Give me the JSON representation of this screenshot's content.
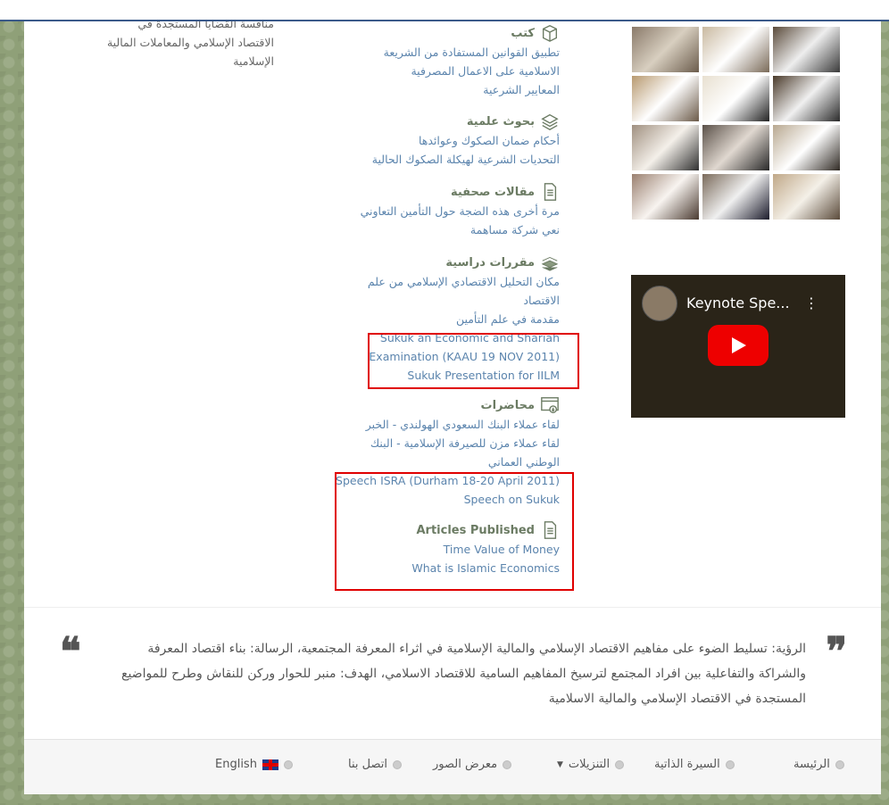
{
  "left_snippet": [
    "منافسة القضايا المستجدة في",
    "الاقتصاد الإسلامي والمعاملات المالية",
    "الإسلامية"
  ],
  "sections": {
    "books": {
      "title": "كتب",
      "icon": "book-icon",
      "links": [
        "تطبيق القوانين المستفادة من الشريعة",
        "الاسلامية على الاعمال المصرفية",
        "المعايير الشرعية"
      ]
    },
    "research": {
      "title": "بحوث علمية",
      "icon": "layers-icon",
      "links": [
        "أحكام ضمان الصكوك وعوائدها",
        "التحديات الشرعية لهيكلة الصكوك الحالية"
      ]
    },
    "press": {
      "title": "مقالات صحفية",
      "icon": "document-icon",
      "links": [
        "مرة أخرى هذه الضجة حول التأمين التعاوني",
        "نعي شركة مساهمة"
      ]
    },
    "courses": {
      "title": "مقررات دراسية",
      "icon": "books-stack-icon",
      "links": [
        "مكان التحليل الاقتصادي الإسلامي من علم",
        "الاقتصاد",
        "مقدمة في علم التأمين",
        "Sukuk an Economic and Shariah",
        "Examination (KAAU 19 NOV 2011)",
        "Sukuk Presentation for IILM"
      ]
    },
    "lectures": {
      "title": "محاضرات",
      "icon": "download-window-icon",
      "links": [
        "لقاء عملاء البنك السعودي الهولندي - الخبر",
        "لقاء عملاء مزن للصيرفة الإسلامية - البنك",
        "الوطني العماني",
        "Speech ISRA (Durham 18-20 April 2011)",
        "Speech on Sukuk"
      ]
    },
    "articles": {
      "title": "Articles Published",
      "icon": "document-icon",
      "links": [
        "Time Value of Money",
        "What is Islamic Economics"
      ]
    }
  },
  "video": {
    "title": "Keynote Spe...",
    "more": "⋮"
  },
  "quote": {
    "text": "الرؤية: تسليط الضوء على مفاهيم الاقتصاد الإسلامي والمالية الإسلامية في اثراء المعرفة المجتمعية، الرسالة: بناء اقتصاد المعرفة والشراكة والتفاعلية بين افراد المجتمع لترسيخ المفاهيم السامية للاقتصاد الاسلامي، الهدف: منبر للحوار وركن للنقاش وطرح للمواضيع المستجدة في الاقتصاد الإسلامي والمالية الاسلامية",
    "open": "❞",
    "close": "❝"
  },
  "nav": {
    "home": "الرئيسة",
    "cv": "السيرة الذاتية",
    "downloads": "التنزيلات",
    "gallery": "معرض الصور",
    "contact": "اتصل بنا",
    "english": "English"
  },
  "colors": {
    "link": "#5b84ad",
    "highlight_box": "#e00000",
    "background": "#8fa078"
  }
}
